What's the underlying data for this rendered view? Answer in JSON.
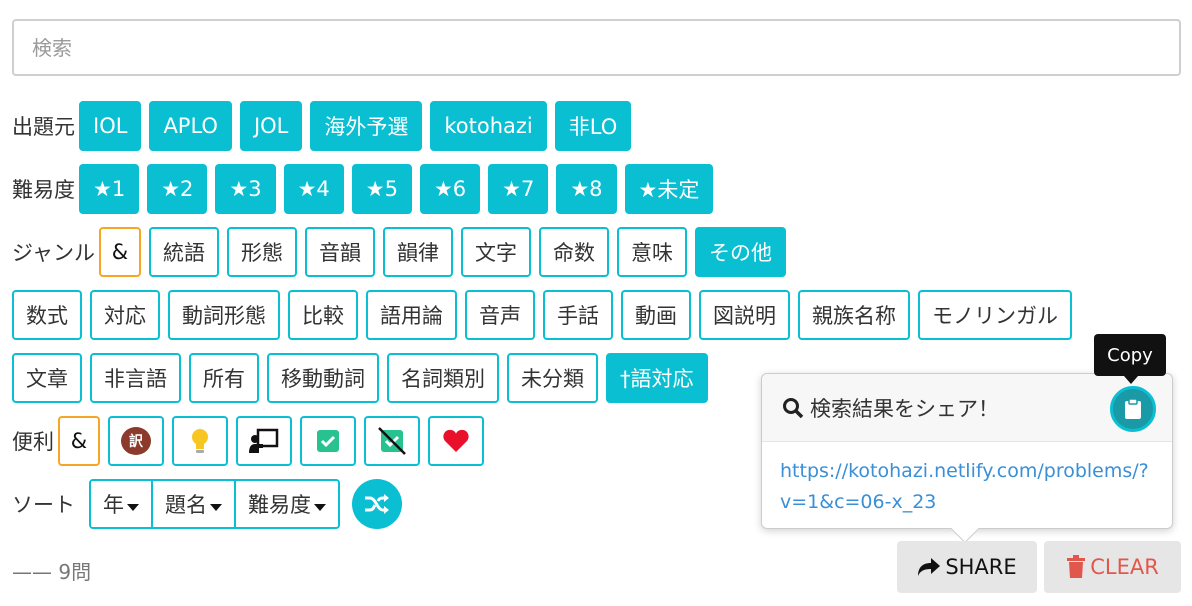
{
  "search": {
    "placeholder": "検索"
  },
  "source": {
    "label": "出題元",
    "buttons": [
      "IOL",
      "APLO",
      "JOL",
      "海外予選",
      "kotohazi",
      "非LO"
    ]
  },
  "difficulty": {
    "label": "難易度",
    "buttons": [
      "★1",
      "★2",
      "★3",
      "★4",
      "★5",
      "★6",
      "★7",
      "★8",
      "★未定"
    ]
  },
  "genre": {
    "label": "ジャンル",
    "amp": "&",
    "row1": [
      "統語",
      "形態",
      "音韻",
      "韻律",
      "文字",
      "命数",
      "意味"
    ],
    "row1_active": "その他",
    "row2": [
      "数式",
      "対応",
      "動詞形態",
      "比較",
      "語用論",
      "音声",
      "手話",
      "動画",
      "図説明",
      "親族名称",
      "モノリンガル"
    ],
    "row3": [
      "文章",
      "非言語",
      "所有",
      "移動動詞",
      "名詞類別",
      "未分類"
    ],
    "row3_active": "†語対応"
  },
  "convenience": {
    "label": "便利",
    "amp": "&",
    "icons": [
      "translation-icon",
      "lightbulb-icon",
      "presentation-icon",
      "checked-box-icon",
      "unchecked-crossed-icon",
      "heart-icon"
    ],
    "translation_glyph": "訳"
  },
  "sort": {
    "label": "ソート",
    "options": [
      "年",
      "題名",
      "難易度"
    ]
  },
  "result": {
    "count": "—— 9問"
  },
  "share": {
    "label": "SHARE"
  },
  "clear": {
    "label": "CLEAR"
  },
  "popover": {
    "title": "検索結果をシェア！",
    "url": "https://kotohazi.netlify.com/problems/?v=1&c=06-x_23"
  },
  "tooltip": {
    "text": "Copy"
  },
  "colors": {
    "accent": "#0bbfd3",
    "amp_border": "#f5a623",
    "clear": "#e2574c",
    "link": "#3a8fd6"
  }
}
